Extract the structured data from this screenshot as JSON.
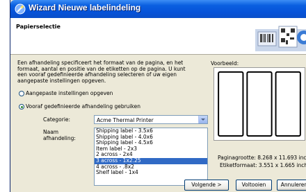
{
  "window": {
    "title": "Wizard Nieuwe labelindeling"
  },
  "header": {
    "page_title": "Papierselectie"
  },
  "description": "Een afhandeling specificeert het formaat van de pagina, en het\nformaat, aantal en positie van de etiketten op de pagina. U kunt\neen vooraf gedefinieerde afhandeling selecteren of uw eigen\naangepaste instellingen opgeven.",
  "options": {
    "custom_label": "Aangepaste instellingen opgeven",
    "predefined_label": "Vooraf gedefinieerde afhandeling gebruiken",
    "selected": "predefined"
  },
  "category": {
    "label": "Categorie:",
    "value": "Acme Thermal Printer"
  },
  "handling": {
    "label_line1": "Naam",
    "label_line2": "afhandeling:",
    "items": [
      "Shipping label - 3.5x6",
      "Shipping label - 4.0x6",
      "Shipping label - 4.5x6",
      "Item label - 2x3",
      "2 across - 2x4",
      "3 across - 1x2.25",
      "4 across - .8x2",
      "Shelf label - 1x4"
    ],
    "selected_index": 5
  },
  "preview": {
    "label": "Voorbeeld:",
    "columns": 3
  },
  "info": {
    "page_size": "Paginagrootte: 8.268 x 11.693 inch",
    "label_size": "Etiketformaat: 3.551 x 1.665 inch"
  },
  "buttons": {
    "next": "Volgende >",
    "finish": "Voltooien",
    "cancel": "Annuleren"
  },
  "colors": {
    "titlebar": "#0a5fe0",
    "selection": "#316ac5",
    "dialog_bg": "#ece9d8"
  }
}
